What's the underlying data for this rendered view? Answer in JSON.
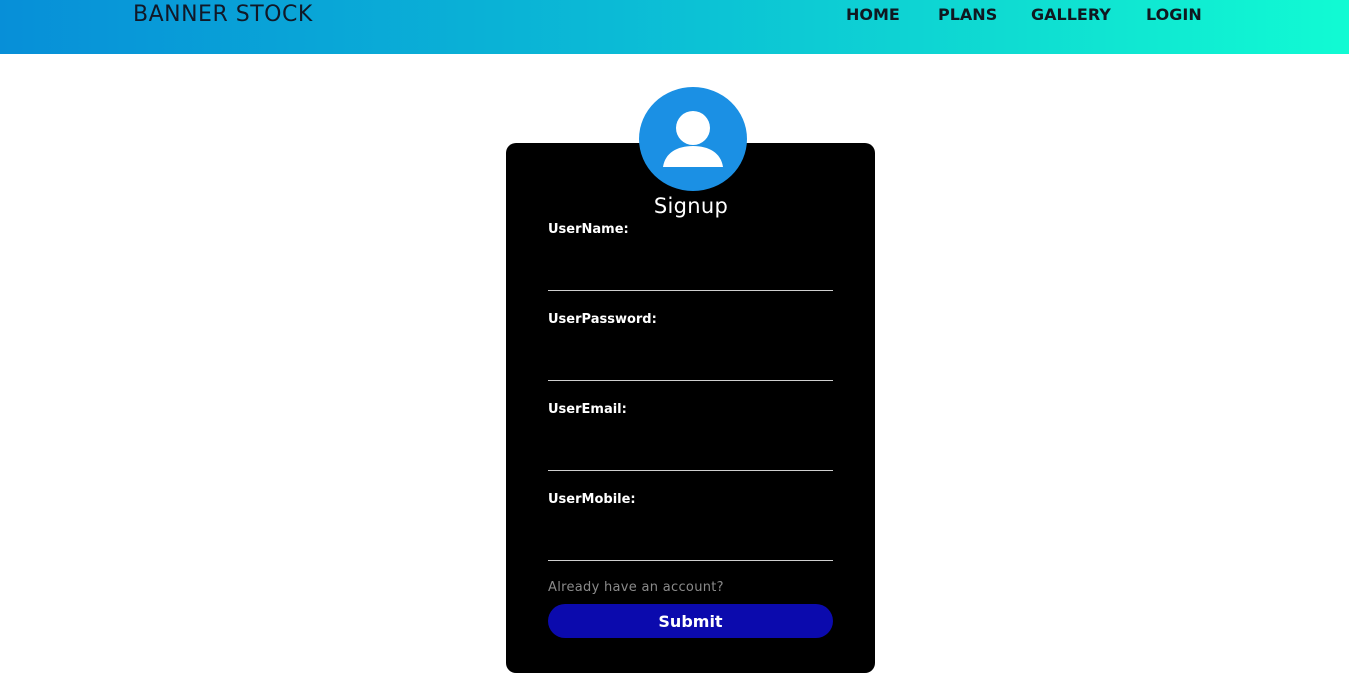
{
  "header": {
    "brand": "BANNER STOCK",
    "nav": {
      "home": "HOME",
      "plans": "PLANS",
      "gallery": "GALLERY",
      "login": "LOGIN"
    },
    "gradient_colors": [
      "#078fd8",
      "#11fbd3"
    ]
  },
  "form": {
    "avatar_icon": "user-icon",
    "avatar_color": "#1b90e4",
    "title": "Signup",
    "fields": [
      {
        "label": "UserName:",
        "value": ""
      },
      {
        "label": "UserPassword:",
        "value": ""
      },
      {
        "label": "UserEmail:",
        "value": ""
      },
      {
        "label": "UserMobile:",
        "value": ""
      }
    ],
    "account_link": "Already have an account?",
    "submit_label": "Submit",
    "submit_color": "#0b0aad",
    "card_color": "#000000"
  }
}
